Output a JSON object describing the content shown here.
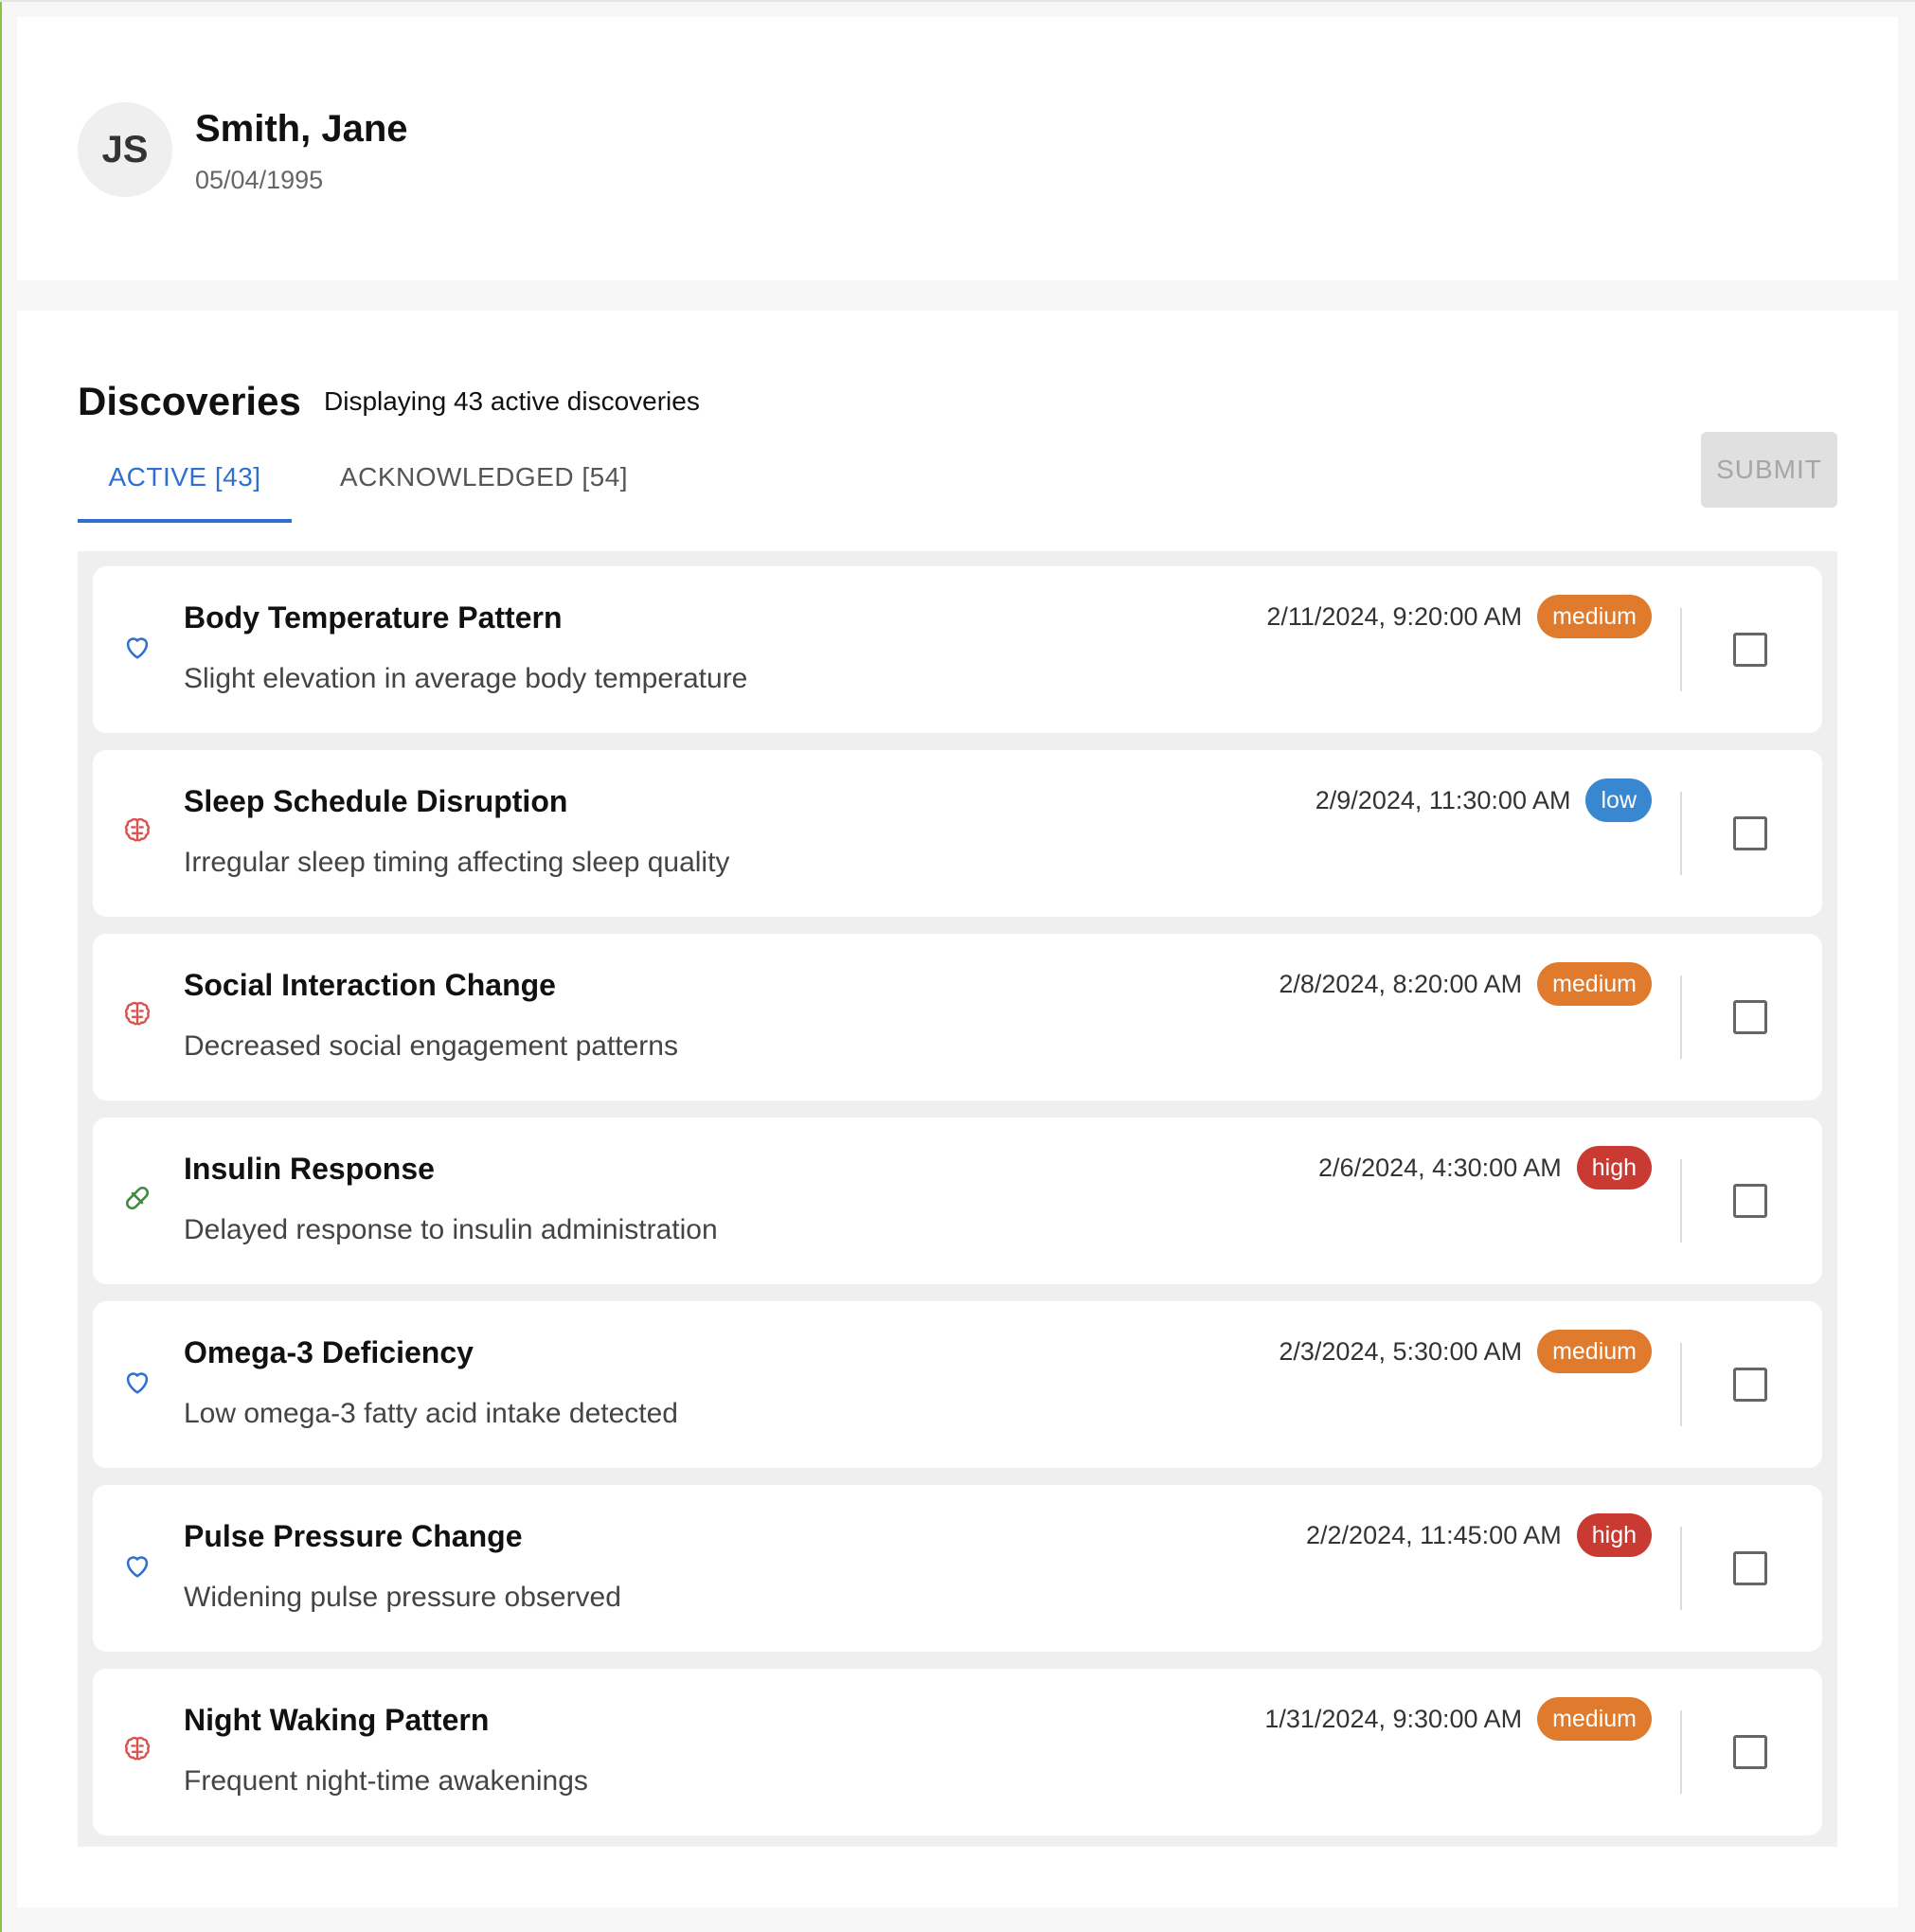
{
  "patient": {
    "initials": "JS",
    "name": "Smith, Jane",
    "dob": "05/04/1995"
  },
  "discoveries": {
    "title": "Discoveries",
    "subtitle": "Displaying 43 active discoveries",
    "submit_label": "SUBMIT",
    "tabs": [
      {
        "label": "ACTIVE [43]",
        "active": true
      },
      {
        "label": "ACKNOWLEDGED [54]",
        "active": false
      }
    ]
  },
  "severity_colors": {
    "low": "#3a87d1",
    "medium": "#e07a2c",
    "high": "#c93a33"
  },
  "items": [
    {
      "icon": "heart-icon",
      "title": "Body Temperature Pattern",
      "description": "Slight elevation in average body temperature",
      "date": "2/11/2024, 9:20:00 AM",
      "severity": "medium",
      "checked": false
    },
    {
      "icon": "brain-icon",
      "title": "Sleep Schedule Disruption",
      "description": "Irregular sleep timing affecting sleep quality",
      "date": "2/9/2024, 11:30:00 AM",
      "severity": "low",
      "checked": false
    },
    {
      "icon": "brain-icon",
      "title": "Social Interaction Change",
      "description": "Decreased social engagement patterns",
      "date": "2/8/2024, 8:20:00 AM",
      "severity": "medium",
      "checked": false
    },
    {
      "icon": "pill-icon",
      "title": "Insulin Response",
      "description": "Delayed response to insulin administration",
      "date": "2/6/2024, 4:30:00 AM",
      "severity": "high",
      "checked": false
    },
    {
      "icon": "heart-icon",
      "title": "Omega-3 Deficiency",
      "description": "Low omega-3 fatty acid intake detected",
      "date": "2/3/2024, 5:30:00 AM",
      "severity": "medium",
      "checked": false
    },
    {
      "icon": "heart-icon",
      "title": "Pulse Pressure Change",
      "description": "Widening pulse pressure observed",
      "date": "2/2/2024, 11:45:00 AM",
      "severity": "high",
      "checked": false
    },
    {
      "icon": "brain-icon",
      "title": "Night Waking Pattern",
      "description": "Frequent night-time awakenings",
      "date": "1/31/2024, 9:30:00 AM",
      "severity": "medium",
      "checked": false
    }
  ]
}
